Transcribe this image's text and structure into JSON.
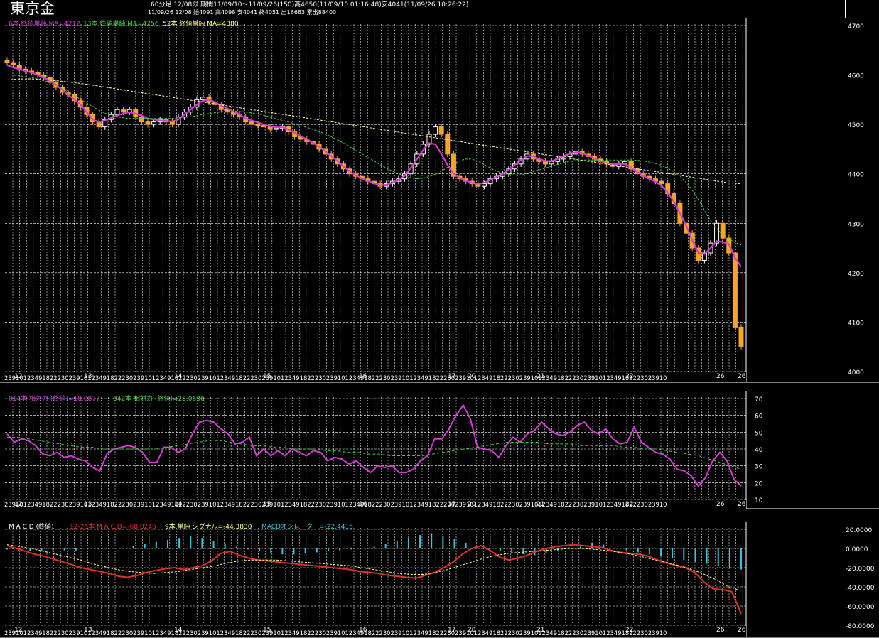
{
  "app": {
    "title": "東京金",
    "info_line1": "60分足  12/08限  期間11/09/10～11/09/26(150)高4650(11/09/10 01:16:48)安4041(11/09/26 10:26:22)",
    "info_line2": "11/09/26 12/08 始4091 高4098 安4041 終4051 出16683 累出88400"
  },
  "colors": {
    "background": "#000000",
    "grid": "#ffffff",
    "up_candle": "#ffffff",
    "down_candle": "#f5a623",
    "ma6": "#d63bd6",
    "ma13": "#3fd13f",
    "ma52": "#ffffa0",
    "rsi14": "#d63bd6",
    "rsi9": "#3fd13f",
    "macd": "#e0302a",
    "signal": "#ffff80",
    "histogram": "#3fc0d8"
  },
  "price_panel": {
    "legend": [
      {
        "text": "6本 終値単純 MA=4212",
        "color": "#d63bd6"
      },
      {
        "text": "13本 終値単純 MA=4256",
        "color": "#3fd13f"
      },
      {
        "text": "52本 終値単純 MA=4380",
        "color": "#ffff80"
      }
    ],
    "y_ticks": [
      "4700",
      "4600",
      "4500",
      "4400",
      "4300",
      "4200",
      "4100",
      "4000"
    ],
    "date_labels": [
      "12",
      "13",
      "14",
      "15",
      "16",
      "17",
      "20",
      "21",
      "22",
      "26",
      "26"
    ]
  },
  "rsi_panel": {
    "legend": [
      {
        "text": "014本 相対力 (終値)=18.0877",
        "color": "#d63bd6"
      },
      {
        "text": "042本 相対力 (終値)=28.0636",
        "color": "#3fd13f"
      }
    ],
    "y_ticks": [
      "70",
      "60",
      "50",
      "40",
      "30",
      "20",
      "10"
    ]
  },
  "macd_panel": {
    "legend": [
      {
        "text": "M A C D (終値)",
        "color": "#ffffff"
      },
      {
        "text": "12-26本 M A C D=-68.0246",
        "color": "#e0302a"
      },
      {
        "text": "9本 単純 シグナル=-44.3830",
        "color": "#ffff80"
      },
      {
        "text": "MACDオシレーター=-22.4415",
        "color": "#3fc0d8"
      }
    ],
    "y_ticks": [
      "20.0000",
      "0.0000",
      "-20.0000",
      "-40.0000",
      "-60.0000",
      "-80.0000"
    ]
  },
  "chart_data": [
    {
      "type": "candlestick",
      "title": "東京金",
      "ylim": [
        4000,
        4700
      ],
      "series": [
        {
          "name": "close",
          "values": [
            4625,
            4620,
            4612,
            4608,
            4605,
            4600,
            4595,
            4585,
            4575,
            4565,
            4560,
            4548,
            4535,
            4520,
            4505,
            4495,
            4510,
            4520,
            4530,
            4525,
            4530,
            4515,
            4505,
            4500,
            4505,
            4510,
            4505,
            4500,
            4515,
            4525,
            4535,
            4550,
            4555,
            4545,
            4540,
            4530,
            4525,
            4520,
            4515,
            4505,
            4500,
            4498,
            4495,
            4490,
            4492,
            4495,
            4485,
            4475,
            4470,
            4465,
            4460,
            4450,
            4440,
            4430,
            4420,
            4410,
            4400,
            4395,
            4390,
            4385,
            4380,
            4375,
            4380,
            4385,
            4390,
            4400,
            4420,
            4440,
            4460,
            4480,
            4495,
            4480,
            4440,
            4395,
            4390,
            4385,
            4380,
            4375,
            4380,
            4390,
            4395,
            4400,
            4410,
            4420,
            4430,
            4440,
            4430,
            4425,
            4420,
            4425,
            4430,
            4435,
            4440,
            4445,
            4440,
            4435,
            4430,
            4425,
            4420,
            4415,
            4420,
            4425,
            4410,
            4400,
            4395,
            4390,
            4385,
            4380,
            4360,
            4340,
            4300,
            4280,
            4250,
            4225,
            4240,
            4260,
            4300,
            4270,
            4240,
            4090,
            4051
          ]
        },
        {
          "name": "6本 終値単純 MA",
          "values": [
            4620,
            4615,
            4612,
            4608,
            4605,
            4600,
            4595,
            4588,
            4580,
            4570,
            4560,
            4550,
            4540,
            4525,
            4510,
            4505,
            4508,
            4513,
            4518,
            4522,
            4525,
            4522,
            4518,
            4512,
            4510,
            4508,
            4507,
            4506,
            4510,
            4520,
            4530,
            4540,
            4548,
            4550,
            4545,
            4538,
            4532,
            4526,
            4520,
            4512,
            4508,
            4504,
            4500,
            4496,
            4494,
            4494,
            4490,
            4483,
            4476,
            4470,
            4463,
            4455,
            4446,
            4436,
            4426,
            4415,
            4405,
            4397,
            4391,
            4386,
            4381,
            4377,
            4378,
            4382,
            4388,
            4396,
            4412,
            4430,
            4448,
            4462,
            4460,
            4440,
            4418,
            4400,
            4392,
            4386,
            4382,
            4380,
            4382,
            4388,
            4394,
            4400,
            4408,
            4418,
            4428,
            4436,
            4436,
            4430,
            4426,
            4426,
            4430,
            4436,
            4441,
            4444,
            4442,
            4437,
            4431,
            4426,
            4421,
            4419,
            4420,
            4420,
            4413,
            4404,
            4396,
            4390,
            4384,
            4376,
            4362,
            4344,
            4320,
            4296,
            4266,
            4240,
            4238,
            4250,
            4264,
            4262,
            4258,
            4230,
            4212
          ]
        },
        {
          "name": "13本 終値単純 MA",
          "values": [
            4600,
            4600,
            4598,
            4596,
            4594,
            4590,
            4586,
            4580,
            4574,
            4566,
            4558,
            4550,
            4542,
            4534,
            4526,
            4520,
            4516,
            4514,
            4512,
            4512,
            4512,
            4512,
            4512,
            4512,
            4512,
            4513,
            4514,
            4515,
            4517,
            4520,
            4522,
            4524,
            4526,
            4527,
            4527,
            4526,
            4524,
            4522,
            4519,
            4515,
            4511,
            4508,
            4504,
            4500,
            4496,
            4492,
            4487,
            4482,
            4476,
            4469,
            4462,
            4454,
            4446,
            4438,
            4430,
            4422,
            4414,
            4407,
            4401,
            4396,
            4392,
            4390,
            4392,
            4396,
            4402,
            4410,
            4418,
            4425,
            4430,
            4430,
            4425,
            4418,
            4410,
            4404,
            4400,
            4398,
            4398,
            4400,
            4404,
            4408,
            4412,
            4416,
            4420,
            4424,
            4426,
            4428,
            4428,
            4428,
            4428,
            4428,
            4428,
            4428,
            4428,
            4428,
            4427,
            4425,
            4422,
            4418,
            4412,
            4404,
            4394,
            4380,
            4362,
            4340,
            4315,
            4295,
            4280,
            4270,
            4262,
            4256
          ]
        },
        {
          "name": "52本 終値単純 MA",
          "values": [
            4590,
            4592,
            4592,
            4590,
            4588,
            4585,
            4582,
            4578,
            4574,
            4570,
            4566,
            4562,
            4558,
            4554,
            4550,
            4546,
            4542,
            4538,
            4534,
            4530,
            4526,
            4522,
            4518,
            4514,
            4510,
            4506,
            4502,
            4498,
            4494,
            4490,
            4486,
            4482,
            4478,
            4474,
            4470,
            4466,
            4462,
            4458,
            4454,
            4450,
            4446,
            4442,
            4438,
            4434,
            4430,
            4426,
            4422,
            4418,
            4414,
            4410,
            4406,
            4402,
            4398,
            4394,
            4390,
            4386,
            4382,
            4380
          ]
        }
      ]
    },
    {
      "type": "line",
      "ylim": [
        10,
        70
      ],
      "series": [
        {
          "name": "014本 相対力 (終値)",
          "values": [
            49,
            44,
            46,
            45,
            42,
            37,
            36,
            38,
            35,
            36,
            34,
            33,
            29,
            27,
            37,
            40,
            41,
            42,
            41,
            38,
            32,
            32,
            41,
            41,
            38,
            40,
            49,
            56,
            57,
            56,
            52,
            49,
            43,
            44,
            47,
            36,
            40,
            36,
            39,
            36,
            40,
            38,
            36,
            39,
            38,
            33,
            35,
            34,
            31,
            33,
            29,
            26,
            30,
            29,
            30,
            26,
            26,
            28,
            33,
            36,
            46,
            46,
            52,
            60,
            66,
            58,
            41,
            40,
            39,
            35,
            42,
            47,
            44,
            49,
            51,
            56,
            52,
            49,
            48,
            50,
            54,
            56,
            51,
            49,
            52,
            46,
            43,
            44,
            53,
            44,
            41,
            38,
            37,
            34,
            28,
            27,
            24,
            18,
            23,
            33,
            38,
            33,
            22,
            18
          ]
        },
        {
          "name": "042本 相対力 (終値)",
          "values": [
            47,
            47,
            46,
            45,
            44,
            43,
            42,
            41,
            41,
            40,
            40,
            40,
            40,
            40,
            40,
            41,
            42,
            43,
            44,
            45,
            45,
            44,
            43,
            42,
            42,
            41,
            41,
            40,
            40,
            40,
            39,
            39,
            38,
            38,
            37,
            37,
            36,
            36,
            36,
            36,
            37,
            38,
            39,
            40,
            41,
            42,
            43,
            44,
            44,
            44,
            44,
            43,
            43,
            43,
            42,
            42,
            42,
            42,
            41,
            41,
            40,
            40,
            39,
            38,
            37,
            36,
            34,
            32,
            30,
            28
          ]
        }
      ]
    },
    {
      "type": "line",
      "ylim": [
        -80,
        20
      ],
      "series": [
        {
          "name": "12-26本 M A C D",
          "values": [
            3,
            0,
            -3,
            -6,
            -8,
            -11,
            -14,
            -17,
            -20,
            -22,
            -24,
            -26,
            -29,
            -30,
            -28,
            -25,
            -23,
            -21,
            -20,
            -22,
            -20,
            -18,
            -13,
            -5,
            -3,
            -7,
            -10,
            -12,
            -13,
            -14,
            -15,
            -16,
            -17,
            -18,
            -19,
            -20,
            -21,
            -22,
            -24,
            -25,
            -26,
            -28,
            -29,
            -30,
            -31,
            -28,
            -25,
            -20,
            -14,
            -6,
            0,
            3,
            -2,
            -9,
            -12,
            -10,
            -7,
            -3,
            0,
            2,
            3,
            4,
            3,
            2,
            1,
            -2,
            -4,
            -5,
            -6,
            -8,
            -12,
            -15,
            -18,
            -20,
            -25,
            -35,
            -42,
            -43,
            -45,
            -68
          ]
        },
        {
          "name": "9本 単純 シグナル",
          "values": [
            4,
            2,
            0,
            -3,
            -6,
            -9,
            -12,
            -16,
            -19,
            -22,
            -24,
            -25,
            -26,
            -25,
            -24,
            -22,
            -20,
            -18,
            -15,
            -13,
            -12,
            -12,
            -12,
            -13,
            -14,
            -15,
            -16,
            -17,
            -18,
            -20,
            -22,
            -24,
            -26,
            -27,
            -27,
            -25,
            -22,
            -18,
            -14,
            -10,
            -7,
            -5,
            -4,
            -3,
            -2,
            -1,
            0,
            0,
            -1,
            -2,
            -4,
            -6,
            -9,
            -12,
            -15,
            -18,
            -22,
            -27,
            -33,
            -40,
            -44
          ]
        },
        {
          "name": "MACDオシレーター",
          "values": [
            -1,
            -2,
            -3,
            -3,
            -2,
            -2,
            -2,
            -1,
            -1,
            0,
            1,
            3,
            5,
            7,
            9,
            11,
            13,
            11,
            8,
            5,
            2,
            -1,
            -3,
            -5,
            -6,
            -6,
            -5,
            -4,
            -3,
            -2,
            -1,
            0,
            2,
            5,
            8,
            11,
            14,
            16,
            13,
            10,
            6,
            2,
            -1,
            -3,
            -5,
            -6,
            -7,
            -5,
            -2,
            1,
            4,
            6,
            4,
            1,
            -2,
            -4,
            -6,
            -8,
            -10,
            -12,
            -14,
            -16,
            -18,
            -20,
            -22
          ]
        }
      ]
    }
  ]
}
